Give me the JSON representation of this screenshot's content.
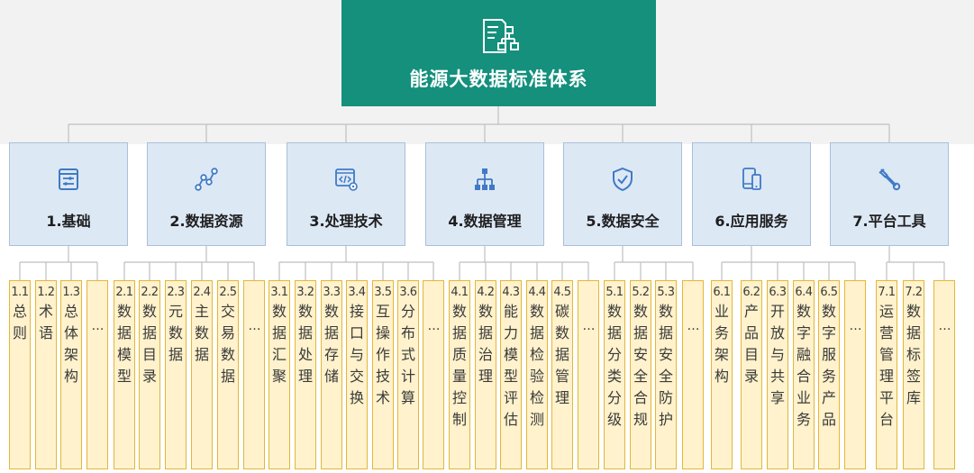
{
  "root": {
    "title": "能源大数据标准体系",
    "icon": "structure-document-icon"
  },
  "colors": {
    "root_bg": "#14907c",
    "category_bg": "#dde8f5",
    "category_border": "#a9bfdc",
    "leaf_bg": "#fff2cc",
    "leaf_border": "#e3b73a",
    "icon_blue": "#3f7ac5",
    "connector": "#bfbfbf"
  },
  "categories": [
    {
      "label": "1.基础",
      "icon": "settings-panel-icon",
      "items": [
        {
          "num": "1.1",
          "text": "总则"
        },
        {
          "num": "1.2",
          "text": "术语"
        },
        {
          "num": "1.3",
          "text": "总体架构"
        },
        {
          "num": "",
          "text": "…"
        }
      ]
    },
    {
      "label": "2.数据资源",
      "icon": "data-nodes-icon",
      "items": [
        {
          "num": "2.1",
          "text": "数据模型"
        },
        {
          "num": "2.2",
          "text": "数据目录"
        },
        {
          "num": "2.3",
          "text": "元数据"
        },
        {
          "num": "2.4",
          "text": "主数据"
        },
        {
          "num": "2.5",
          "text": "交易数据"
        },
        {
          "num": "",
          "text": "…"
        }
      ]
    },
    {
      "label": "3.处理技术",
      "icon": "code-settings-icon",
      "items": [
        {
          "num": "3.1",
          "text": "数据汇聚"
        },
        {
          "num": "3.2",
          "text": "数据处理"
        },
        {
          "num": "3.3",
          "text": "数据存储"
        },
        {
          "num": "3.4",
          "text": "接口与交换"
        },
        {
          "num": "3.5",
          "text": "互操作技术"
        },
        {
          "num": "3.6",
          "text": "分布式计算"
        },
        {
          "num": "",
          "text": "…"
        }
      ]
    },
    {
      "label": "4.数据管理",
      "icon": "hierarchy-icon",
      "items": [
        {
          "num": "4.1",
          "text": "数据质量控制"
        },
        {
          "num": "4.2",
          "text": "数据治理"
        },
        {
          "num": "4.3",
          "text": "能力模型评估"
        },
        {
          "num": "4.4",
          "text": "数据检验检测"
        },
        {
          "num": "4.5",
          "text": "碳数据管理"
        },
        {
          "num": "",
          "text": "…"
        }
      ]
    },
    {
      "label": "5.数据安全",
      "icon": "shield-check-icon",
      "items": [
        {
          "num": "5.1",
          "text": "数据分类分级"
        },
        {
          "num": "5.2",
          "text": "数据安全合规"
        },
        {
          "num": "5.3",
          "text": "数据安全防护"
        },
        {
          "num": "",
          "text": "…"
        }
      ]
    },
    {
      "label": "6.应用服务",
      "icon": "devices-icon",
      "items": [
        {
          "num": "6.1",
          "text": "业务架构"
        },
        {
          "num": "6.2",
          "text": "产品目录"
        },
        {
          "num": "6.3",
          "text": "开放与共享"
        },
        {
          "num": "6.4",
          "text": "数字融合业务"
        },
        {
          "num": "6.5",
          "text": "数字服务产品"
        },
        {
          "num": "",
          "text": "…"
        }
      ]
    },
    {
      "label": "7.平台工具",
      "icon": "wrench-icon",
      "items": [
        {
          "num": "7.1",
          "text": "运营管理平台"
        },
        {
          "num": "7.2",
          "text": "数据标签库"
        },
        {
          "num": "",
          "text": "…"
        }
      ]
    }
  ]
}
